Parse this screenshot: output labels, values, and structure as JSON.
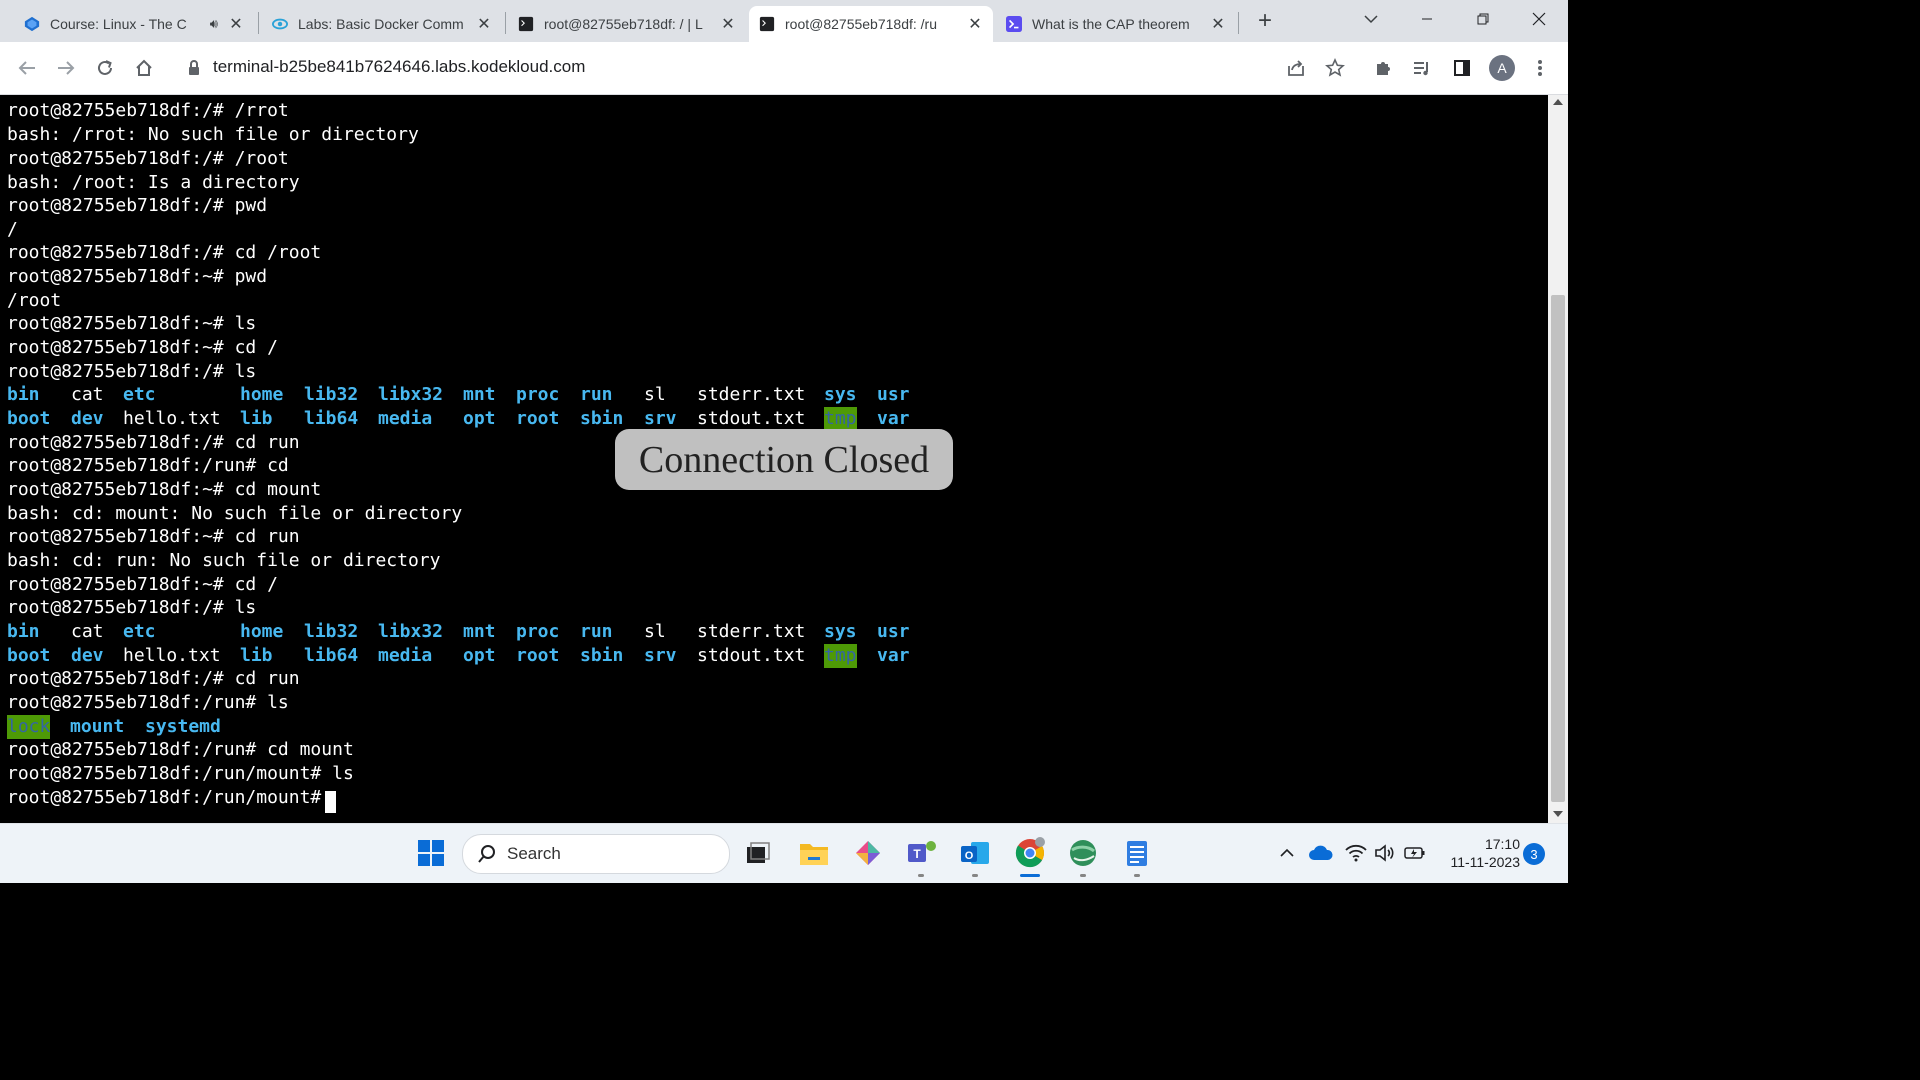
{
  "browser": {
    "tabs": [
      {
        "title": "Course: Linux - The C",
        "favicon": "kodekloud-icon",
        "audio": true
      },
      {
        "title": "Labs: Basic Docker Comm",
        "favicon": "labs-icon"
      },
      {
        "title": "root@82755eb718df: / | L",
        "favicon": "terminal-icon"
      },
      {
        "title": "root@82755eb718df: /ru",
        "favicon": "terminal-icon",
        "active": true
      },
      {
        "title": "What is the CAP theorem",
        "favicon": "prompt-icon"
      }
    ],
    "url": "terminal-b25be841b7624646.labs.kodekloud.com",
    "profile_initial": "A"
  },
  "terminal": {
    "lines": [
      "root@82755eb718df:/# /rrot",
      "bash: /rrot: No such file or directory",
      "root@82755eb718df:/# /root",
      "bash: /root: Is a directory",
      "root@82755eb718df:/# pwd",
      "/",
      "root@82755eb718df:/# cd /root",
      "root@82755eb718df:~# pwd",
      "/root",
      "root@82755eb718df:~# ls",
      "root@82755eb718df:~# cd /",
      "root@82755eb718df:/# ls",
      null,
      null,
      "root@82755eb718df:/# cd run",
      "root@82755eb718df:/run# cd",
      "root@82755eb718df:~# cd mount",
      "bash: cd: mount: No such file or directory",
      "root@82755eb718df:~# cd run",
      "bash: cd: run: No such file or directory",
      "root@82755eb718df:~# cd /",
      "root@82755eb718df:/# ls",
      null,
      null,
      "root@82755eb718df:/# cd run",
      "root@82755eb718df:/run# ls",
      null,
      "root@82755eb718df:/run# cd mount",
      "root@82755eb718df:/run/mount# ls",
      "root@82755eb718df:/run/mount# "
    ],
    "ls_root": {
      "row1": [
        "bin",
        "cat",
        "etc",
        "home",
        "lib32",
        "libx32",
        "mnt",
        "proc",
        "run",
        "sl",
        "stderr.txt",
        "sys",
        "usr"
      ],
      "row2": [
        "boot",
        "dev",
        "hello.txt",
        "lib",
        "lib64",
        "media",
        "opt",
        "root",
        "sbin",
        "srv",
        "stdout.txt",
        "tmp",
        "var"
      ]
    },
    "ls_run": [
      "lock",
      "mount",
      "systemd"
    ],
    "overlay_text": "Connection Closed"
  },
  "taskbar": {
    "search_placeholder": "Search",
    "time": "17:10",
    "date": "11-11-2023",
    "notification_count": "3"
  }
}
